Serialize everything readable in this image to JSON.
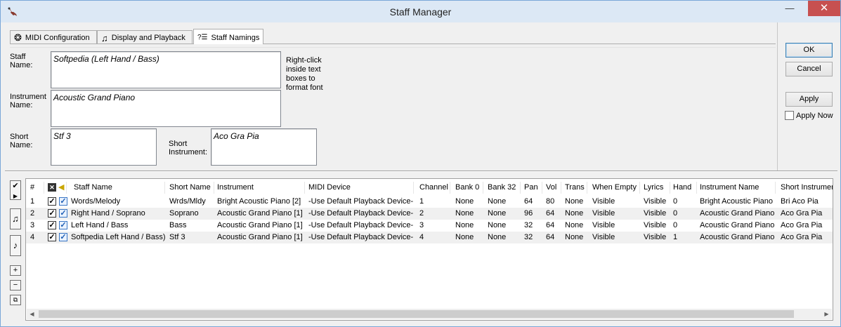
{
  "window": {
    "title": "Staff Manager"
  },
  "tabs": [
    {
      "label": "MIDI Configuration",
      "icon": "film-reel-icon"
    },
    {
      "label": "Display and Playback",
      "icon": "music-notes-icon"
    },
    {
      "label": "Staff Namings",
      "icon": "question-list-icon",
      "active": true
    }
  ],
  "form": {
    "staff_name_label": "Staff Name:",
    "staff_name_value": "Softpedia (Left Hand / Bass)",
    "instrument_name_label": "Instrument Name:",
    "instrument_name_value": "Acoustic Grand Piano",
    "short_name_label": "Short Name:",
    "short_name_value": "Stf 3",
    "short_instrument_label": "Short Instrument:",
    "short_instrument_value": "Aco Gra Pia",
    "hint": "Right-click inside text boxes to format font"
  },
  "buttons": {
    "ok": "OK",
    "cancel": "Cancel",
    "apply": "Apply",
    "apply_now": "Apply Now"
  },
  "grid": {
    "columns": [
      "#",
      "",
      "",
      "Staff Name",
      "Short Name",
      "Instrument",
      "MIDI Device",
      "Channel",
      "Bank 0",
      "Bank 32",
      "Pan",
      "Vol",
      "Trans",
      "When Empty",
      "Lyrics",
      "Hand",
      "Instrument Name",
      "Short Instrumen"
    ],
    "rows": [
      {
        "num": "1",
        "staff": "Words/Melody",
        "short": "Wrds/Mldy",
        "instrument": "Bright Acoustic Piano [2]",
        "device": "-Use Default Playback Device-",
        "channel": "1",
        "bank0": "None",
        "bank32": "None",
        "pan": "64",
        "vol": "80",
        "trans": "None",
        "empty": "Visible",
        "lyrics": "Visible",
        "hand": "0",
        "iname": "Bright Acoustic Piano",
        "sinstr": "Bri Aco Pia"
      },
      {
        "num": "2",
        "staff": "Right Hand / Soprano",
        "short": "Soprano",
        "instrument": "Acoustic Grand Piano [1]",
        "device": "-Use Default Playback Device-",
        "channel": "2",
        "bank0": "None",
        "bank32": "None",
        "pan": "96",
        "vol": "64",
        "trans": "None",
        "empty": "Visible",
        "lyrics": "Visible",
        "hand": "0",
        "iname": "Acoustic Grand Piano",
        "sinstr": "Aco Gra Pia"
      },
      {
        "num": "3",
        "staff": "Left Hand / Bass",
        "short": "Bass",
        "instrument": "Acoustic Grand Piano [1]",
        "device": "-Use Default Playback Device-",
        "channel": "3",
        "bank0": "None",
        "bank32": "None",
        "pan": "32",
        "vol": "64",
        "trans": "None",
        "empty": "Visible",
        "lyrics": "Visible",
        "hand": "0",
        "iname": "Acoustic Grand Piano",
        "sinstr": "Aco Gra Pia"
      },
      {
        "num": "4",
        "staff": "Softpedia Left Hand / Bass)",
        "short": "Stf 3",
        "instrument": "Acoustic Grand Piano [1]",
        "device": "-Use Default Playback Device-",
        "channel": "4",
        "bank0": "None",
        "bank32": "None",
        "pan": "32",
        "vol": "64",
        "trans": "None",
        "empty": "Visible",
        "lyrics": "Visible",
        "hand": "1",
        "iname": "Acoustic Grand Piano",
        "sinstr": "Aco Gra Pia"
      }
    ]
  },
  "icons": {
    "app": "sibelius-app-icon",
    "minimize": "minimize-icon",
    "close": "close-icon",
    "tools": [
      "check-select-icon",
      "move-staff-up-icon",
      "move-staff-down-icon",
      "add-staff-icon",
      "remove-staff-icon",
      "copy-staff-icon"
    ]
  },
  "colors": {
    "titlebar": "#dce8f5",
    "close": "#c75050",
    "grid_alt_row": "#f0f0f0"
  }
}
